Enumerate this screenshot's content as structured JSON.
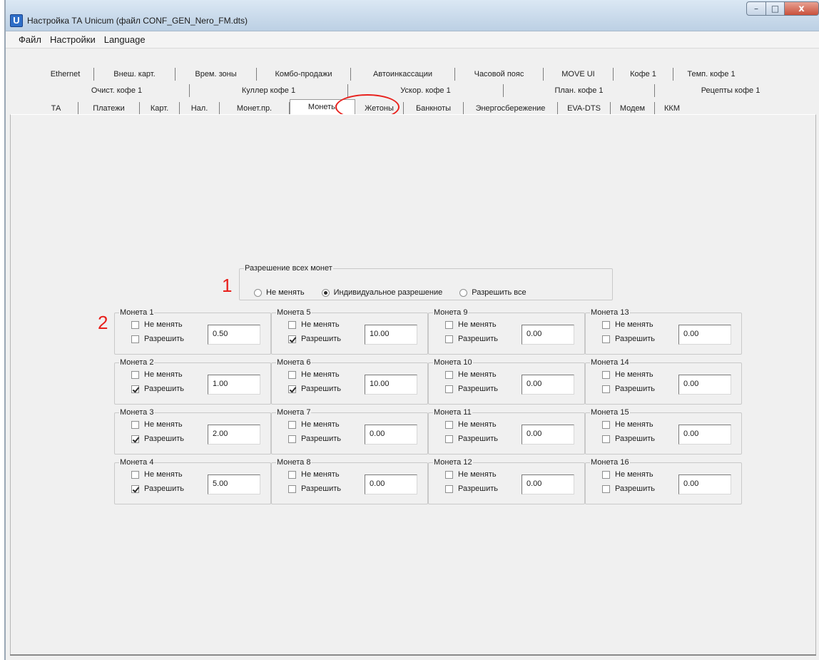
{
  "window": {
    "icon": "U",
    "title": "Настройка ТА Unicum (файл CONF_GEN_Nero_FM.dts)",
    "controls": {
      "minimize": "–",
      "maximize": "□",
      "close": "x"
    }
  },
  "menu": [
    "Файл",
    "Настройки",
    "Language"
  ],
  "tabs": {
    "row1": [
      "Ethernet",
      "Внеш. карт.",
      "Врем. зоны",
      "Комбо-продажи",
      "Автоинкассации",
      "Часовой пояс",
      "MOVE UI",
      "Кофе 1",
      "Темп. кофе 1"
    ],
    "row2": [
      "Очист. кофе 1",
      "Куллер кофе 1",
      "Ускор. кофе 1",
      "План. кофе 1",
      "Рецепты кофе 1"
    ],
    "row3": [
      "ТА",
      "Платежи",
      "Карт.",
      "Нал.",
      "Монет.пр.",
      "Монеты",
      "Жетоны",
      "Банкноты",
      "Энергосбережение",
      "EVA-DTS",
      "Модем",
      "ККМ"
    ],
    "active": "Монеты"
  },
  "all_coins": {
    "legend": "Разрешение всех монет",
    "options": [
      "Не менять",
      "Индивидуальное разрешение",
      "Разрешить все"
    ],
    "selected": "Индивидуальное разрешение"
  },
  "coin_labels": {
    "no_change": "Не менять",
    "allow": "Разрешить"
  },
  "coins": [
    {
      "label": "Монета 1",
      "no_change": false,
      "allow": false,
      "value": "0.50"
    },
    {
      "label": "Монета 2",
      "no_change": false,
      "allow": true,
      "value": "1.00"
    },
    {
      "label": "Монета 3",
      "no_change": false,
      "allow": true,
      "value": "2.00"
    },
    {
      "label": "Монета 4",
      "no_change": false,
      "allow": true,
      "value": "5.00"
    },
    {
      "label": "Монета 5",
      "no_change": false,
      "allow": true,
      "value": "10.00"
    },
    {
      "label": "Монета 6",
      "no_change": false,
      "allow": true,
      "value": "10.00"
    },
    {
      "label": "Монета 7",
      "no_change": false,
      "allow": false,
      "value": "0.00"
    },
    {
      "label": "Монета 8",
      "no_change": false,
      "allow": false,
      "value": "0.00"
    },
    {
      "label": "Монета 9",
      "no_change": false,
      "allow": false,
      "value": "0.00"
    },
    {
      "label": "Монета 10",
      "no_change": false,
      "allow": false,
      "value": "0.00"
    },
    {
      "label": "Монета 11",
      "no_change": false,
      "allow": false,
      "value": "0.00"
    },
    {
      "label": "Монета 12",
      "no_change": false,
      "allow": false,
      "value": "0.00"
    },
    {
      "label": "Монета 13",
      "no_change": false,
      "allow": false,
      "value": "0.00"
    },
    {
      "label": "Монета 14",
      "no_change": false,
      "allow": false,
      "value": "0.00"
    },
    {
      "label": "Монета 15",
      "no_change": false,
      "allow": false,
      "value": "0.00"
    },
    {
      "label": "Монета 16",
      "no_change": false,
      "allow": false,
      "value": "0.00"
    }
  ],
  "annotations": {
    "marker1": "1",
    "marker2": "2",
    "color": "#e8201c"
  }
}
